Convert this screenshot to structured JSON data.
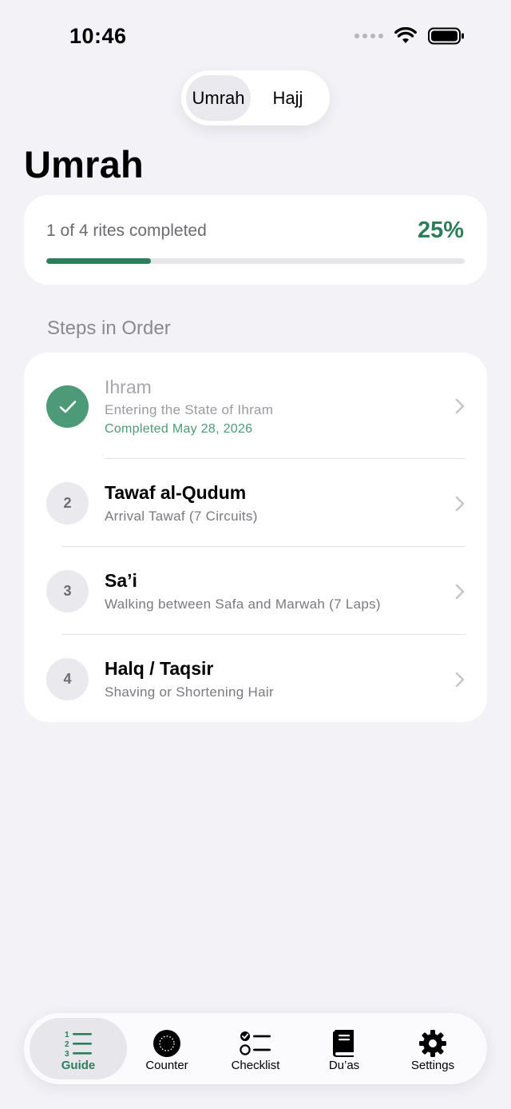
{
  "status_bar": {
    "time": "10:46"
  },
  "segmented": {
    "options": [
      "Umrah",
      "Hajj"
    ],
    "selected": "Umrah"
  },
  "page": {
    "title": "Umrah"
  },
  "progress": {
    "text": "1 of 4 rites completed",
    "percent_label": "25%",
    "fraction": 0.25
  },
  "section": {
    "header": "Steps in Order"
  },
  "steps": [
    {
      "badge": "",
      "title": "Ihram",
      "subtitle": "Entering the State of Ihram",
      "completed": "Completed May 28, 2026",
      "done": true
    },
    {
      "badge": "2",
      "title": "Tawaf al-Qudum",
      "subtitle": "Arrival Tawaf (7 Circuits)",
      "done": false
    },
    {
      "badge": "3",
      "title": "Sa’i",
      "subtitle": "Walking between Safa and Marwah (7 Laps)",
      "done": false
    },
    {
      "badge": "4",
      "title": "Halq / Taqsir",
      "subtitle": "Shaving or Shortening Hair",
      "done": false
    }
  ],
  "tabs": [
    {
      "label": "Guide",
      "icon": "numbered-list-icon",
      "active": true
    },
    {
      "label": "Counter",
      "icon": "counter-icon",
      "active": false
    },
    {
      "label": "Checklist",
      "icon": "checklist-icon",
      "active": false
    },
    {
      "label": "Du’as",
      "icon": "book-icon",
      "active": false
    },
    {
      "label": "Settings",
      "icon": "gear-icon",
      "active": false
    }
  ],
  "colors": {
    "accent": "#2E7D5B",
    "done_green": "#4C9A78",
    "background": "#F2F2F7"
  }
}
